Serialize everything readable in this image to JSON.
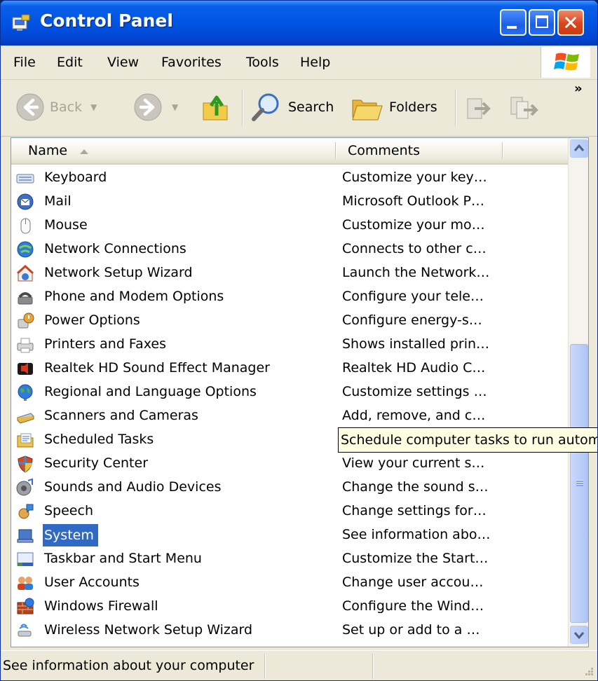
{
  "window": {
    "title": "Control Panel"
  },
  "menu": {
    "items": [
      "File",
      "Edit",
      "View",
      "Favorites",
      "Tools",
      "Help"
    ]
  },
  "toolbar": {
    "back_label": "Back",
    "search_label": "Search",
    "folders_label": "Folders",
    "chevron": "»"
  },
  "columns": {
    "name": "Name",
    "comments": "Comments"
  },
  "items": [
    {
      "name": "Keyboard",
      "comment": "Customize your key…",
      "icon": "keyboard-icon"
    },
    {
      "name": "Mail",
      "comment": "Microsoft Outlook P…",
      "icon": "mail-icon"
    },
    {
      "name": "Mouse",
      "comment": "Customize your mo…",
      "icon": "mouse-icon"
    },
    {
      "name": "Network Connections",
      "comment": "Connects to other c…",
      "icon": "network-icon"
    },
    {
      "name": "Network Setup Wizard",
      "comment": "Launch the Network…",
      "icon": "network-wizard-icon"
    },
    {
      "name": "Phone and Modem Options",
      "comment": "Configure your tele…",
      "icon": "phone-icon"
    },
    {
      "name": "Power Options",
      "comment": "Configure energy-s…",
      "icon": "power-icon"
    },
    {
      "name": "Printers and Faxes",
      "comment": "Shows installed prin…",
      "icon": "printer-icon"
    },
    {
      "name": "Realtek HD Sound Effect Manager",
      "comment": "Realtek HD Audio C…",
      "icon": "speaker-icon"
    },
    {
      "name": "Regional and Language Options",
      "comment": "Customize settings …",
      "icon": "globe-icon"
    },
    {
      "name": "Scanners and Cameras",
      "comment": "Add, remove, and c…",
      "icon": "scanner-icon"
    },
    {
      "name": "Scheduled Tasks",
      "comment": "",
      "icon": "scheduled-tasks-icon"
    },
    {
      "name": "Security Center",
      "comment": "View your current s…",
      "icon": "shield-icon"
    },
    {
      "name": "Sounds and Audio Devices",
      "comment": "Change the sound s…",
      "icon": "sound-icon"
    },
    {
      "name": "Speech",
      "comment": "Change settings for…",
      "icon": "speech-icon"
    },
    {
      "name": "System",
      "comment": "See information abo…",
      "icon": "system-icon"
    },
    {
      "name": "Taskbar and Start Menu",
      "comment": "Customize the Start…",
      "icon": "taskbar-icon"
    },
    {
      "name": "User Accounts",
      "comment": "Change user accou…",
      "icon": "users-icon"
    },
    {
      "name": "Windows Firewall",
      "comment": "Configure the Wind…",
      "icon": "firewall-icon"
    },
    {
      "name": "Wireless Network Setup Wizard",
      "comment": "Set up or add to a …",
      "icon": "wireless-icon"
    }
  ],
  "selected_item": "System",
  "tooltip": {
    "text": "Schedule computer tasks to run autom"
  },
  "status": {
    "text": "See information about your computer"
  },
  "colors": {
    "title_bar": "#0054e3",
    "selection": "#316ac5",
    "tooltip_bg": "#ffffe1",
    "close_button": "#d9461d"
  }
}
